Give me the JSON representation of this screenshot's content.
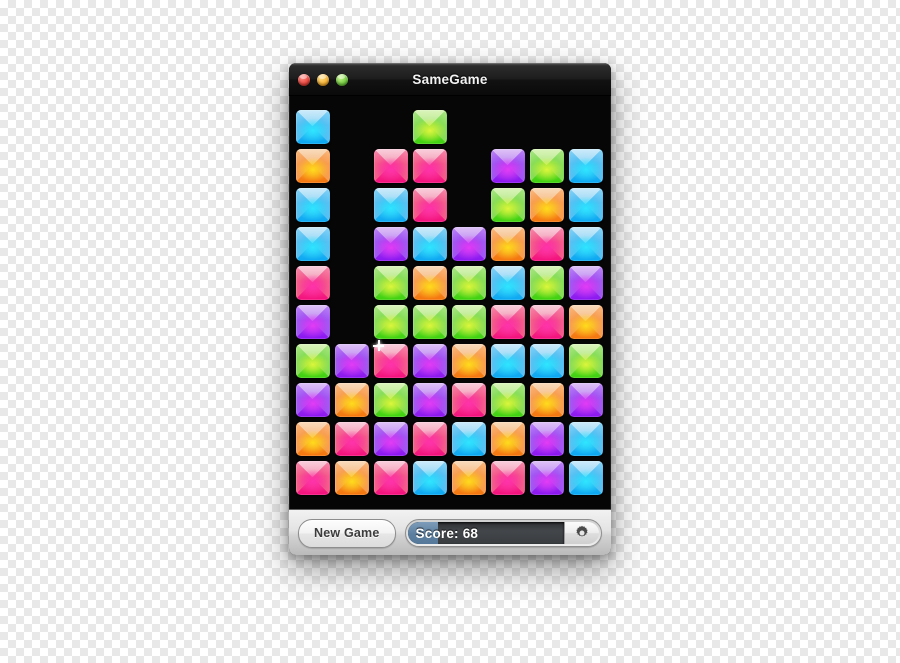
{
  "window": {
    "title": "SameGame",
    "traffic_lights": [
      {
        "name": "close-button",
        "color": "#e8453c"
      },
      {
        "name": "minimize-button",
        "color": "#f5b032"
      },
      {
        "name": "zoom-button",
        "color": "#70c93e"
      }
    ]
  },
  "toolbar": {
    "new_game_label": "New Game",
    "score_label": "Score: 68",
    "score_value": 68,
    "gear_icon": "gear-icon",
    "score_fill_color": "#5d7f9f"
  },
  "board": {
    "columns": 8,
    "rows": 10,
    "tile_size": 34,
    "cell_pitch": 39,
    "background_color": "#060606",
    "palette": {
      "blue": {
        "top": "#aadcf5",
        "side": "#4fb8ef",
        "bottom": "#12a9f0",
        "glow": "#3fe0ff"
      },
      "green": {
        "top": "#c8ef9a",
        "side": "#86d95a",
        "bottom": "#3fd411",
        "glow": "#d8f542"
      },
      "orange": {
        "top": "#f6c99a",
        "side": "#f79d4c",
        "bottom": "#f5750d",
        "glow": "#ffd91e"
      },
      "pink": {
        "top": "#f6b9cc",
        "side": "#f25d86",
        "bottom": "#f5117f",
        "glow": "#ff35a8"
      },
      "purple": {
        "top": "#cfa9f2",
        "side": "#a martial"
      }
    },
    "grid": [
      [
        "blue",
        null,
        null,
        "green",
        null,
        null,
        null,
        null
      ],
      [
        "orange",
        null,
        "pink",
        "pink",
        null,
        "purple",
        "green",
        "blue"
      ],
      [
        "blue",
        null,
        "blue",
        "pink",
        null,
        "green",
        "orange",
        "blue"
      ],
      [
        "blue",
        null,
        "purple",
        "blue",
        "purple",
        "orange",
        "pink",
        "blue"
      ],
      [
        "pink",
        null,
        "green",
        "orange",
        "green",
        "blue",
        "green",
        "purple"
      ],
      [
        "purple",
        null,
        "green",
        "green",
        "green",
        "pink",
        "pink",
        "orange"
      ],
      [
        "green",
        "purple",
        "pink",
        "purple",
        "orange",
        "blue",
        "blue",
        "green"
      ],
      [
        "purple",
        "orange",
        "green",
        "purple",
        "pink",
        "green",
        "orange",
        "purple"
      ],
      [
        "orange",
        "pink",
        "purple",
        "pink",
        "blue",
        "orange",
        "purple",
        "blue"
      ],
      [
        "pink",
        "orange",
        "pink",
        "blue",
        "orange",
        "pink",
        "purple",
        "blue"
      ]
    ],
    "cursor": {
      "name": "sparkle-cursor",
      "col": 2,
      "row": 6
    }
  }
}
